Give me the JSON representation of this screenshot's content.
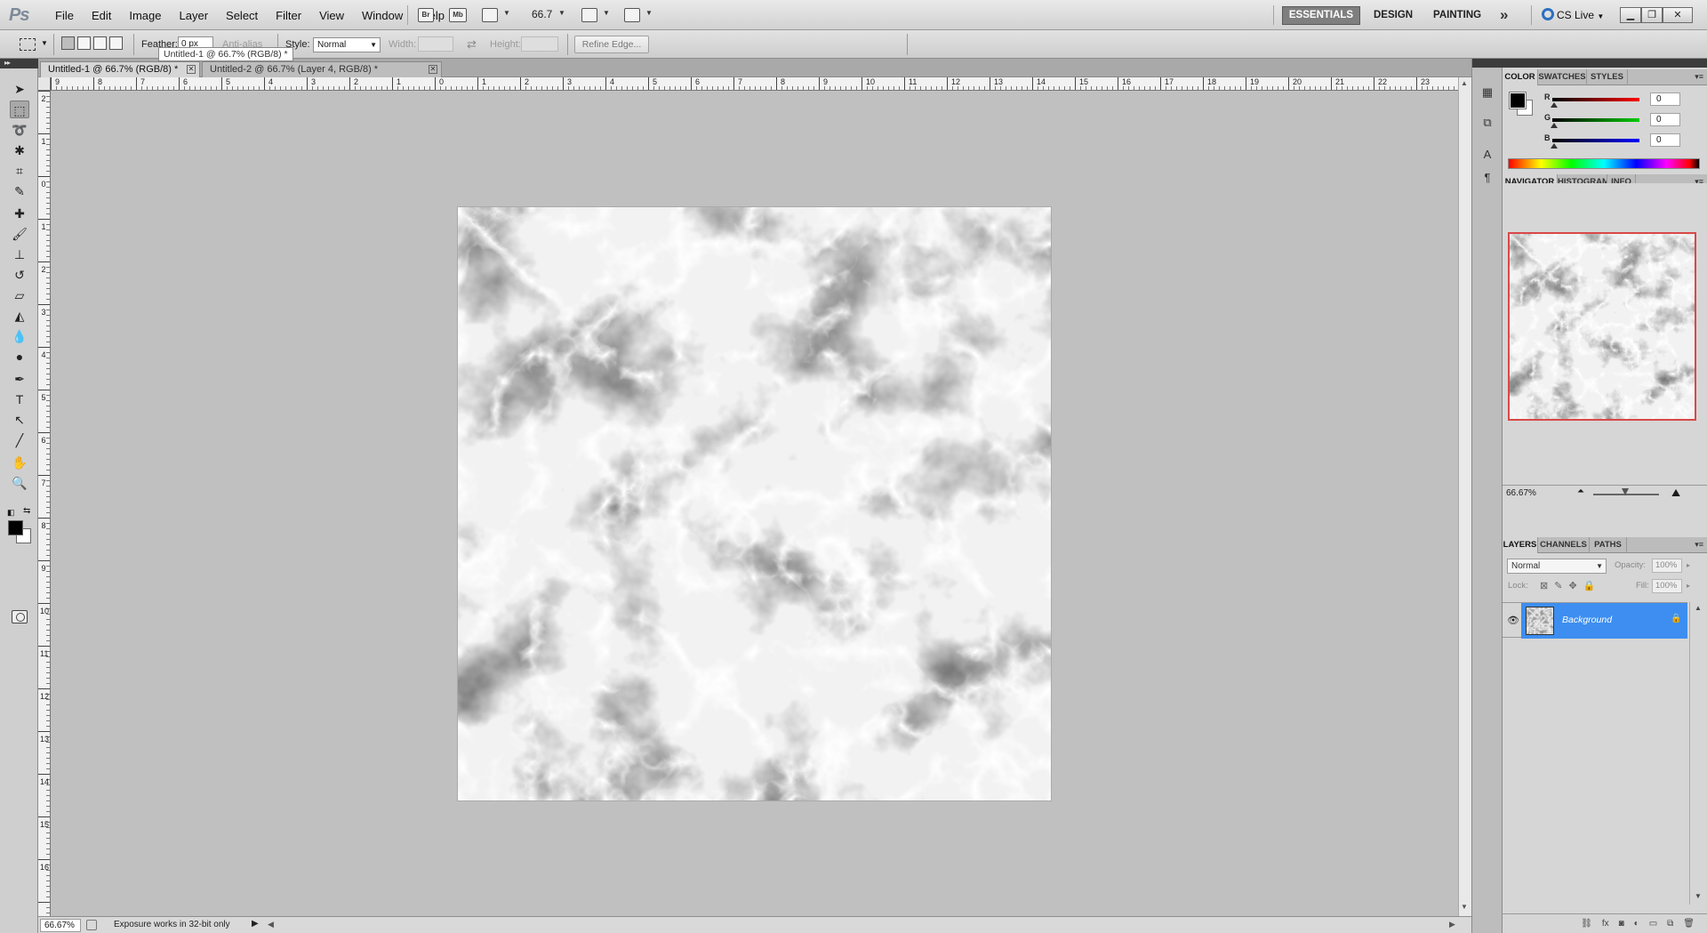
{
  "app": {
    "logo": "Ps",
    "menu": [
      "File",
      "Edit",
      "Image",
      "Layer",
      "Select",
      "Filter",
      "View",
      "Window",
      "Help"
    ],
    "bridge_label": "Br",
    "minibridge_label": "Mb",
    "zoom_level": "66.7",
    "workspaces": {
      "active": "ESSENTIALS",
      "others": [
        "DESIGN",
        "PAINTING"
      ],
      "more": "»"
    },
    "cs_live": "CS Live"
  },
  "options": {
    "feather_label": "Feather:",
    "feather_value": "0 px",
    "antialias_label": "Anti-alias",
    "style_label": "Style:",
    "style_value": "Normal",
    "width_label": "Width:",
    "height_label": "Height:",
    "refine_edge": "Refine Edge...",
    "tooltip": "Untitled-1 @ 66.7% (RGB/8) *"
  },
  "documents": [
    {
      "title": "Untitled-1 @ 66.7% (RGB/8) *",
      "active": true
    },
    {
      "title": "Untitled-2 @ 66.7% (Layer 4, RGB/8) *",
      "active": false
    }
  ],
  "tools": [
    "move-tool",
    "rectangular-marquee-tool",
    "lasso-tool",
    "quick-selection-tool",
    "crop-tool",
    "eyedropper-tool",
    "spot-healing-brush-tool",
    "brush-tool",
    "clone-stamp-tool",
    "history-brush-tool",
    "eraser-tool",
    "paint-bucket-tool",
    "blur-tool",
    "dodge-tool",
    "pen-tool",
    "type-tool",
    "path-selection-tool",
    "line-tool",
    "hand-tool",
    "zoom-tool"
  ],
  "ruler": {
    "top": [
      "9",
      "8",
      "7",
      "6",
      "5",
      "4",
      "3",
      "2",
      "1",
      "0",
      "1",
      "2",
      "3",
      "4",
      "5",
      "6",
      "7",
      "8",
      "9",
      "10",
      "11",
      "12",
      "13",
      "14",
      "15",
      "16",
      "17",
      "18",
      "19",
      "20",
      "21",
      "22",
      "23"
    ],
    "left": [
      "2",
      "1",
      "0",
      "1",
      "2",
      "3",
      "4",
      "5",
      "6",
      "7",
      "8",
      "9",
      "10",
      "11",
      "12",
      "13",
      "14",
      "15",
      "16"
    ]
  },
  "status": {
    "zoom": "66.67%",
    "message": "Exposure works in 32-bit only"
  },
  "color_panel": {
    "tabs": [
      "COLOR",
      "SWATCHES",
      "STYLES"
    ],
    "sliders": [
      {
        "label": "R",
        "value": "0",
        "color": "#ff0000"
      },
      {
        "label": "G",
        "value": "0",
        "color": "#00b000"
      },
      {
        "label": "B",
        "value": "0",
        "color": "#0000ff"
      }
    ],
    "foreground": "#000000",
    "background": "#ffffff"
  },
  "navigator_panel": {
    "tabs": [
      "NAVIGATOR",
      "HISTOGRAM",
      "INFO"
    ],
    "zoom": "66.67%"
  },
  "layers_panel": {
    "tabs": [
      "LAYERS",
      "CHANNELS",
      "PATHS"
    ],
    "blend_mode": "Normal",
    "opacity_label": "Opacity:",
    "opacity": "100%",
    "lock_label": "Lock:",
    "fill_label": "Fill:",
    "fill": "100%",
    "layers": [
      {
        "name": "Background",
        "selected": true,
        "locked": true
      }
    ]
  },
  "colors": {
    "ui_accent": "#3d8ef0",
    "navigator_frame": "#d94848"
  }
}
